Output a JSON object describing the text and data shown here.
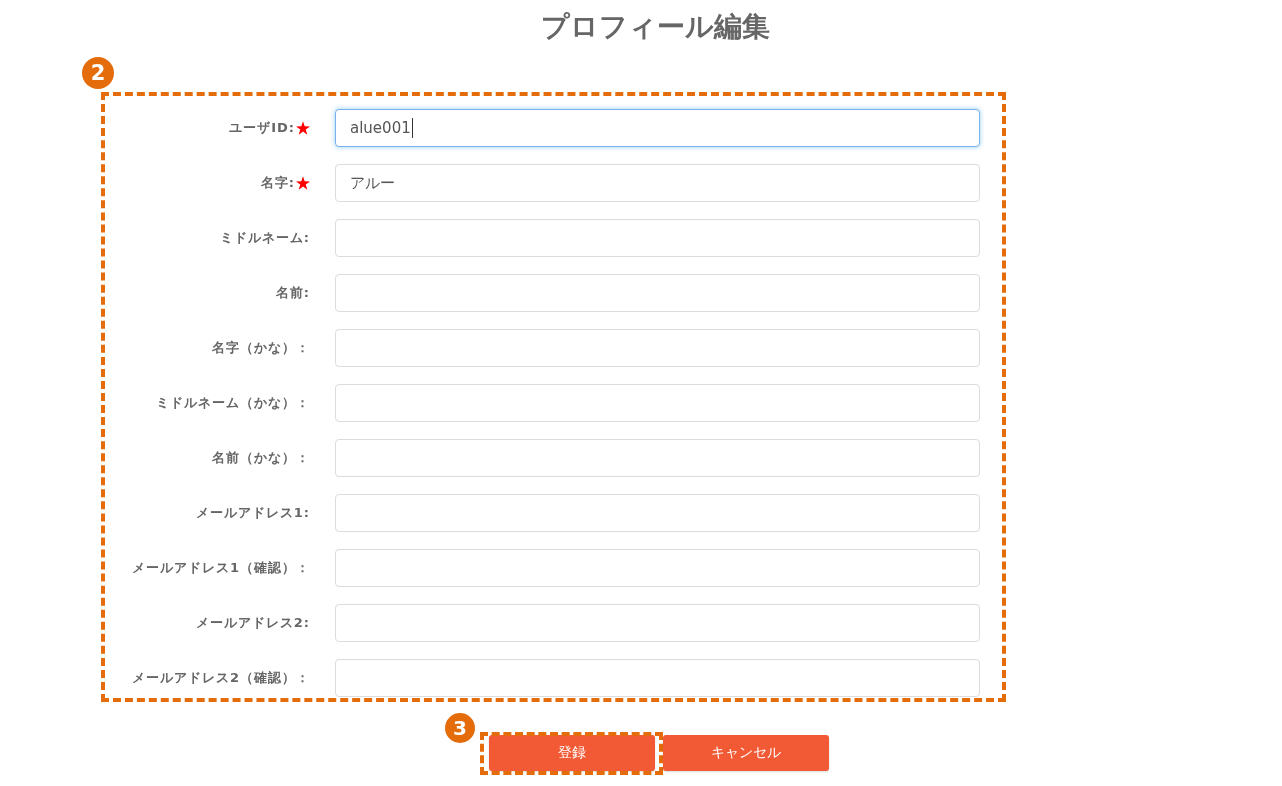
{
  "title": "プロフィール編集",
  "form": {
    "callout": "2",
    "fields": [
      {
        "label": "ユーザID:",
        "required": true,
        "value": "alue001",
        "focused": true
      },
      {
        "label": "名字:",
        "required": true,
        "value": "アルー",
        "focused": false
      },
      {
        "label": "ミドルネーム:",
        "required": false,
        "focused": false
      },
      {
        "label": "名前:",
        "required": false,
        "focused": false
      },
      {
        "label": "名字（かな）：",
        "required": false,
        "focused": false
      },
      {
        "label": "ミドルネーム（かな）：",
        "required": false,
        "focused": false
      },
      {
        "label": "名前（かな）：",
        "required": false,
        "focused": false
      },
      {
        "label": "メールアドレス1:",
        "required": false,
        "focused": false
      },
      {
        "label": "メールアドレス1（確認）：",
        "required": false,
        "focused": false
      },
      {
        "label": "メールアドレス2:",
        "required": false,
        "focused": false
      },
      {
        "label": "メールアドレス2（確認）：",
        "required": false,
        "focused": false
      }
    ]
  },
  "buttons": [
    {
      "label": "登録",
      "callout": "3"
    },
    {
      "label": "キャンセル"
    }
  ]
}
